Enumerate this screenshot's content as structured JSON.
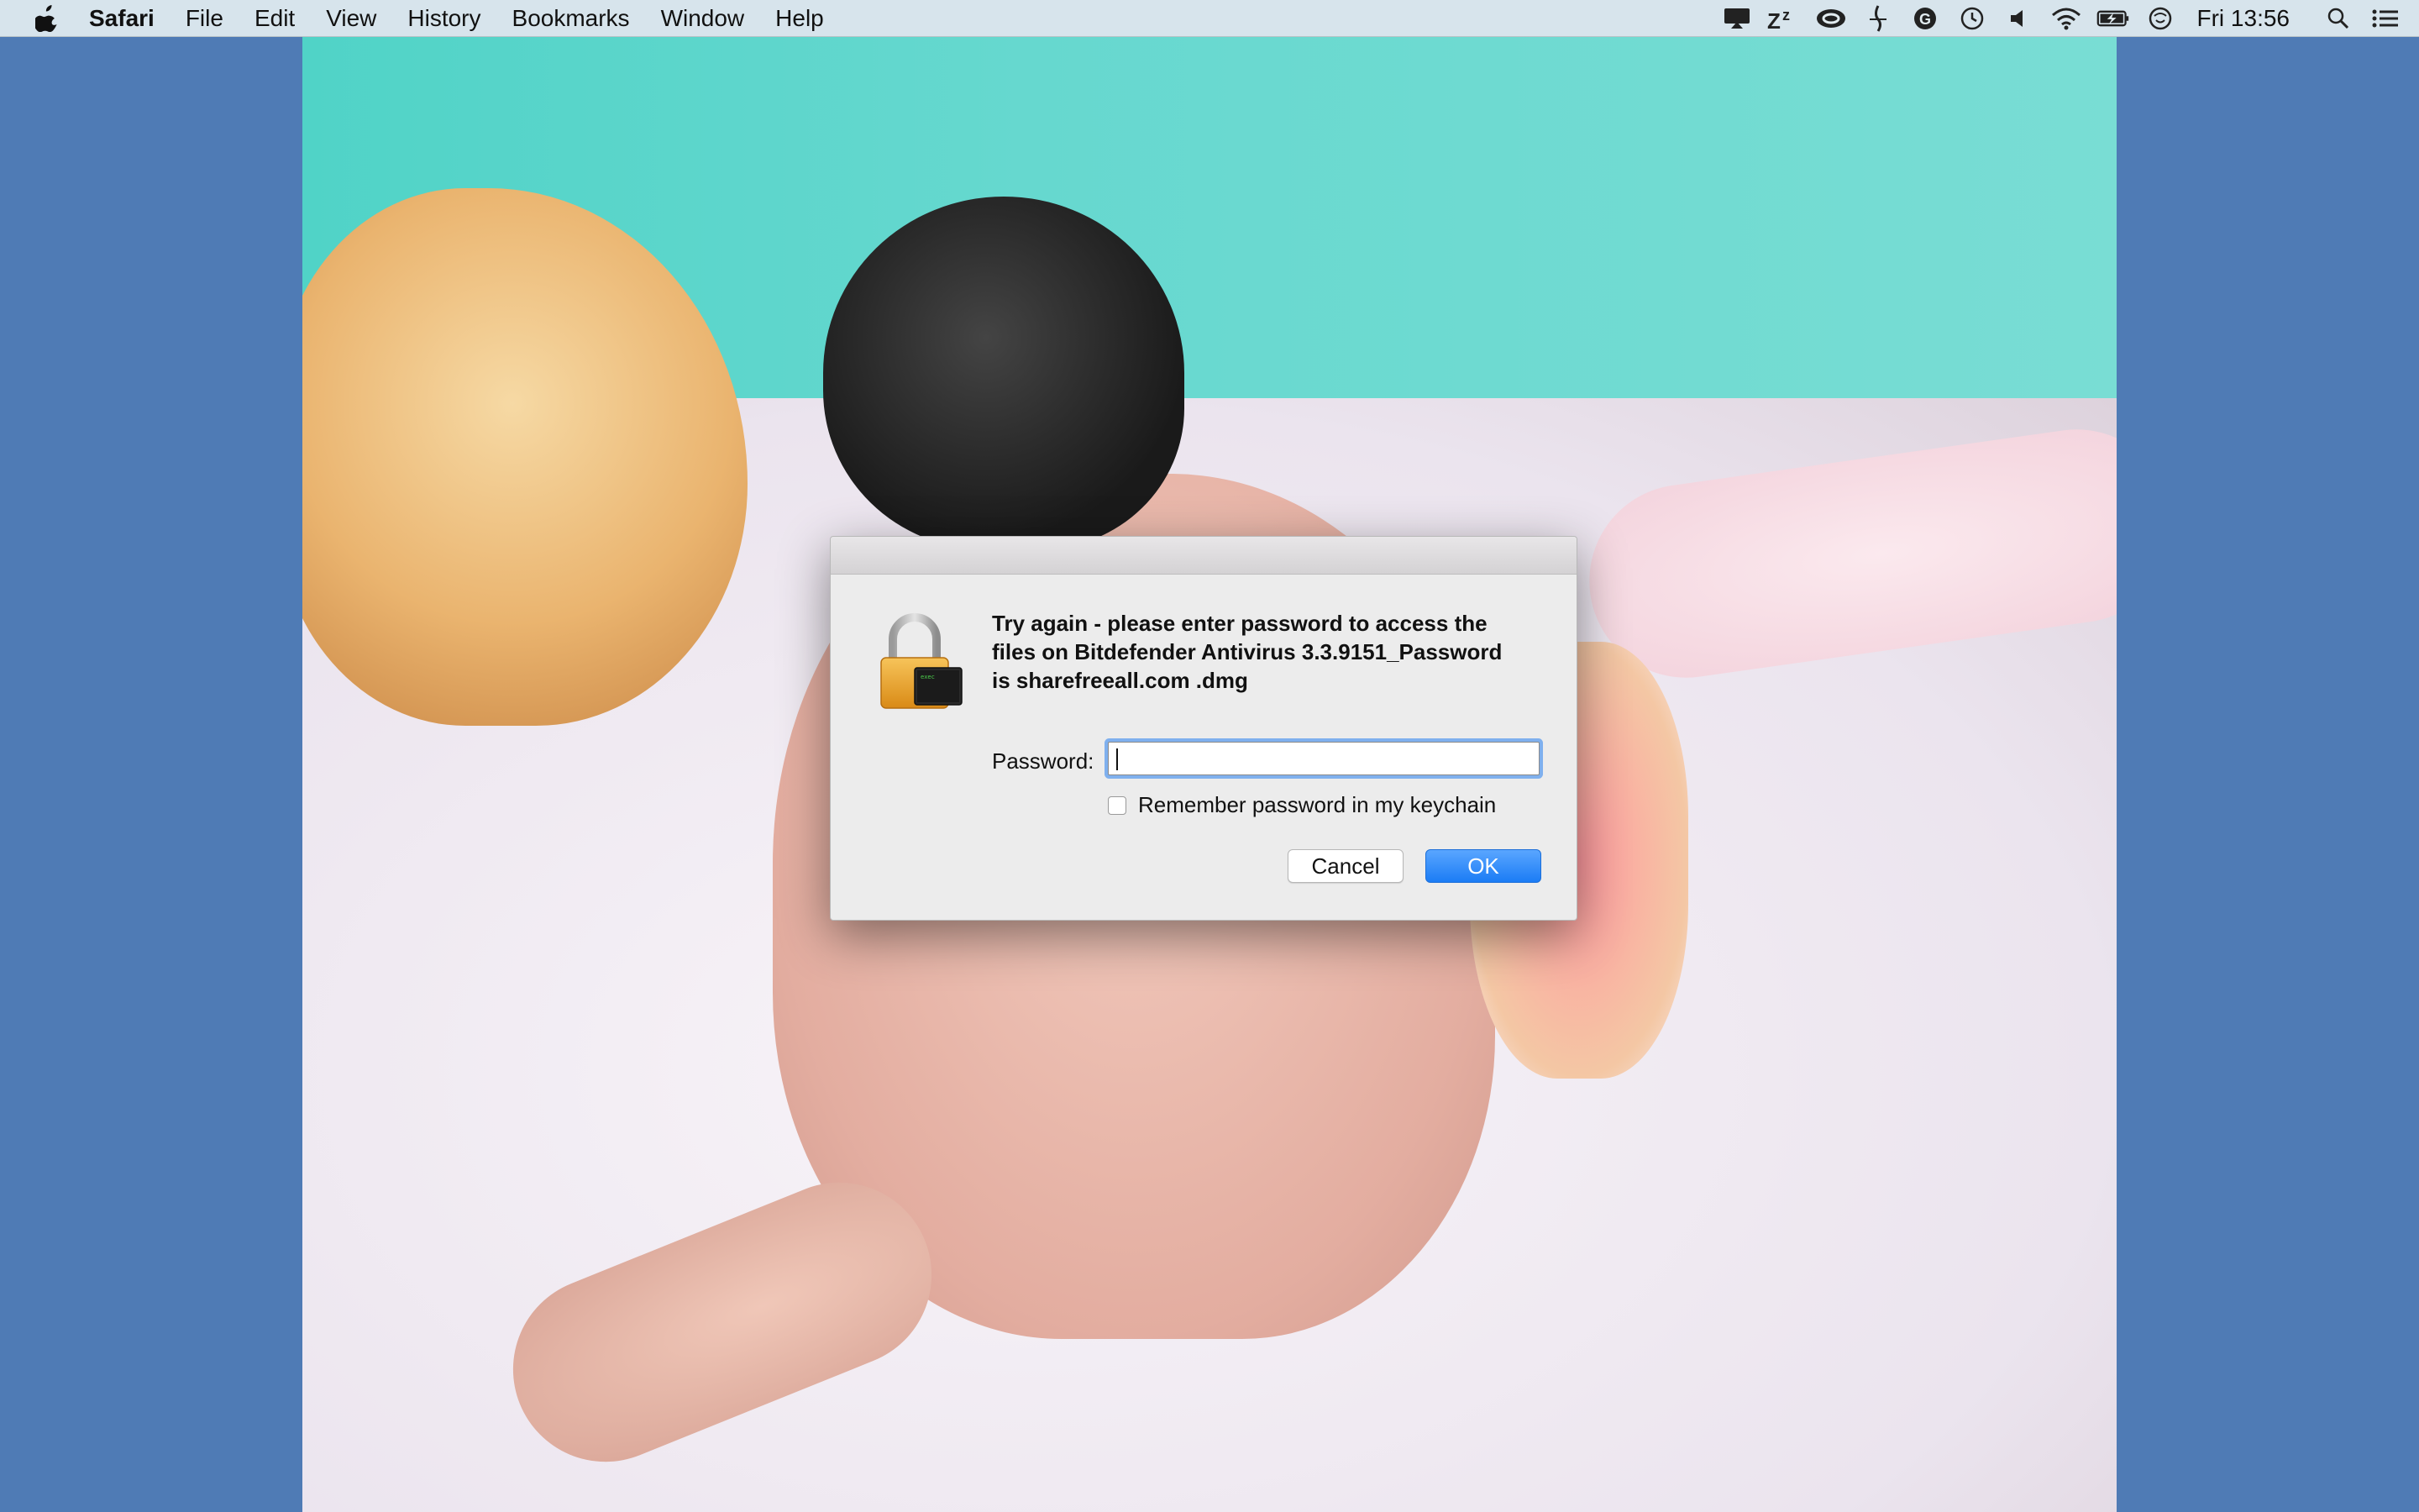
{
  "menubar": {
    "apple_icon": "apple-logo-icon",
    "app_name": "Safari",
    "items": [
      "File",
      "Edit",
      "View",
      "History",
      "Bookmarks",
      "Window",
      "Help"
    ],
    "status_icons": [
      "airplay-display-icon",
      "sleep-zz-icon",
      "creative-cloud-icon",
      "flux-icon",
      "grammarly-icon",
      "time-machine-icon",
      "volume-icon",
      "wifi-icon",
      "battery-charging-icon",
      "vpn-icon"
    ],
    "clock": "Fri 13:56",
    "spotlight_icon": "spotlight-search-icon",
    "notification_icon": "notification-center-icon"
  },
  "dialog": {
    "icon": "lock-terminal-icon",
    "message": "Try again - please enter password to access the\nfiles on Bitdefender Antivirus 3.3.9151_Password\nis  sharefreeall.com .dmg",
    "password_label": "Password:",
    "password_value": "",
    "remember_label": "Remember password in my keychain",
    "remember_checked": false,
    "cancel_label": "Cancel",
    "ok_label": "OK"
  },
  "colors": {
    "desktop": "#4f7bb5",
    "ok_button": "#1b7cf5",
    "focus_ring": "#7fb0ee"
  }
}
